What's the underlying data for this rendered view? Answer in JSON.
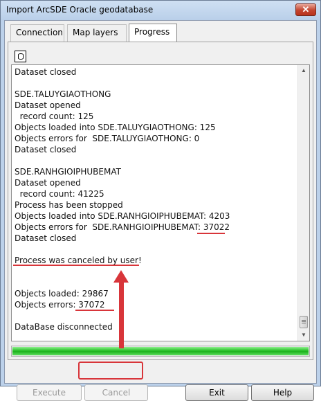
{
  "window": {
    "title": "Import ArcSDE Oracle geodatabase",
    "close_label": "✕"
  },
  "tabs": [
    {
      "label": "Connection"
    },
    {
      "label": "Map layers"
    },
    {
      "label": "Progress"
    }
  ],
  "log": {
    "lines": [
      "Dataset closed",
      "",
      "SDE.TALUYGIAOTHONG",
      "Dataset opened",
      "  record count: 125",
      "Objects loaded into SDE.TALUYGIAOTHONG: 125",
      "Objects errors for  SDE.TALUYGIAOTHONG: 0",
      "Dataset closed",
      "",
      "SDE.RANHGIOIPHUBEMAT",
      "Dataset opened",
      "  record count: 41225",
      "Process has been stopped",
      "Objects loaded into SDE.RANHGIOIPHUBEMAT: 4203",
      "Objects errors for  SDE.RANHGIOIPHUBEMAT: 37022",
      "Dataset closed",
      "",
      "Process was canceled by user!",
      "",
      "",
      "Objects loaded: 29867",
      "Objects errors: 37072",
      "",
      "DataBase disconnected"
    ]
  },
  "progress": {
    "value": 1.0,
    "color": "#22bb22"
  },
  "buttons": {
    "execute": "Execute",
    "cancel": "Cancel",
    "exit": "Exit",
    "help": "Help"
  },
  "annotation_color": "#d8353a"
}
